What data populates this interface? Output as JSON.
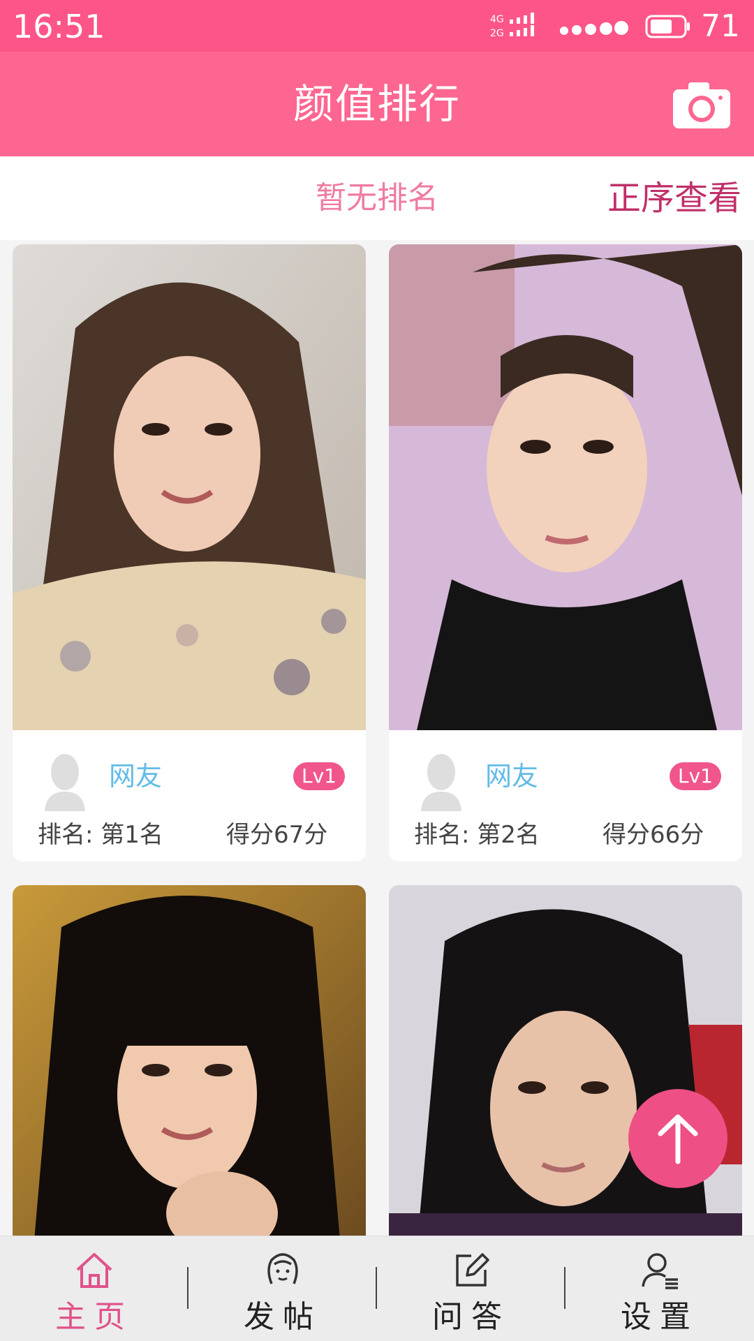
{
  "status_bar": {
    "time": "16:51",
    "battery": "71",
    "signal_labels": [
      "4G",
      "2G"
    ]
  },
  "header": {
    "title": "颜值排行",
    "camera_icon": "camera-icon"
  },
  "subbar": {
    "rank_status": "暂无排名",
    "sort_label": "正序查看"
  },
  "cards": [
    {
      "nickname": "网友",
      "level": "Lv1",
      "rank": "排名: 第1名",
      "score": "得分67分"
    },
    {
      "nickname": "网友",
      "level": "Lv1",
      "rank": "排名: 第2名",
      "score": "得分66分"
    },
    {
      "nickname": "",
      "level": "",
      "rank": "",
      "score": ""
    },
    {
      "nickname": "",
      "level": "",
      "rank": "",
      "score": ""
    }
  ],
  "fab": {
    "icon": "arrow-up-icon"
  },
  "tabbar": {
    "active_index": 0,
    "items": [
      {
        "label": "主页",
        "icon": "home-icon"
      },
      {
        "label": "发帖",
        "icon": "face-icon"
      },
      {
        "label": "问答",
        "icon": "edit-icon"
      },
      {
        "label": "设置",
        "icon": "user-settings-icon"
      }
    ]
  },
  "colors": {
    "status_bar": "#fd5588",
    "header": "#fd6690",
    "accent": "#e0528a",
    "nickname": "#63bce6",
    "level_badge": "#f0568c"
  }
}
